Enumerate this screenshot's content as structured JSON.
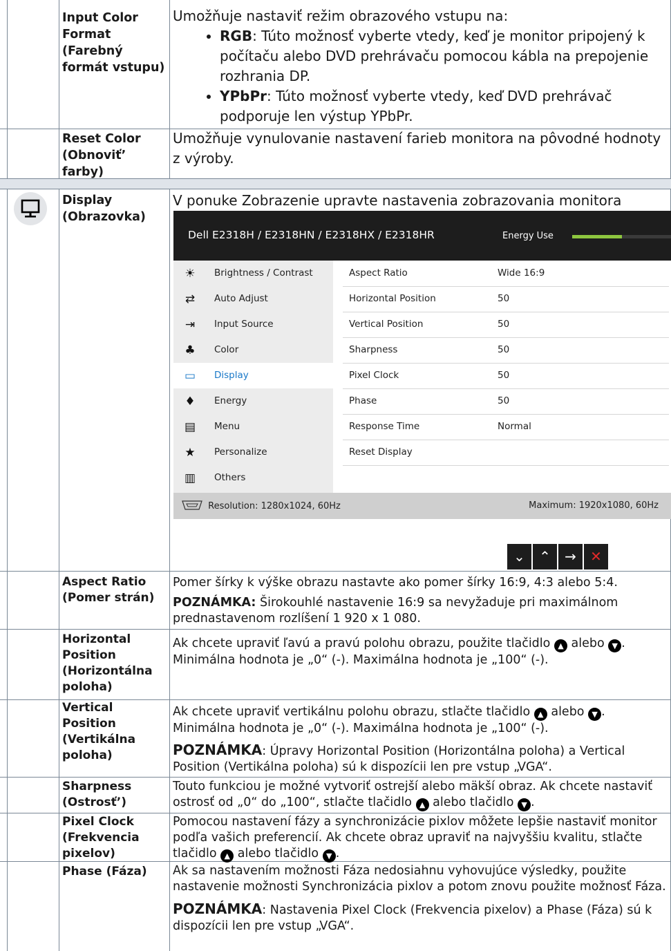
{
  "rows": {
    "input_color": {
      "label": [
        "Input Color",
        "Format",
        "(Farebný",
        "formát vstupu)"
      ],
      "desc_intro": "Umožňuje nastaviť režim obrazového vstupu na:",
      "bullets": [
        {
          "term": "RGB",
          "text": ": Túto možnosť vyberte vtedy, keď je monitor pripojený k počítaču alebo DVD prehrávaču pomocou kábla na prepojenie rozhrania DP."
        },
        {
          "term": "YPbPr",
          "text": ": Túto možnosť vyberte vtedy, keď DVD prehrávač podporuje len výstup YPbPr."
        }
      ]
    },
    "reset_color": {
      "label": [
        "Reset Color",
        "(Obnoviť’",
        "farby)"
      ],
      "desc": "Umožňuje vynulovanie nastavení farieb monitora na pôvodné hodnoty z výroby."
    },
    "display": {
      "label": [
        "Display",
        "(Obrazovka)"
      ],
      "desc": "V ponuke Zobrazenie upravte nastavenia zobrazovania monitora"
    },
    "aspect": {
      "label": [
        "Aspect Ratio",
        "(Pomer strán)"
      ],
      "desc": "Pomer šírky k výške obrazu nastavte ako pomer šírky 16:9, 4:3 alebo 5:4.",
      "note_prefix": "POZNÁMKA:",
      "note": " Širokouhlé nastavenie 16:9 sa nevyžaduje pri maximálnom prednastavenom rozlíšení 1 920 x 1 080."
    },
    "hpos": {
      "label": [
        "Horizontal",
        "Position",
        "(Horizontálna",
        "poloha)"
      ],
      "desc_a": "Ak chcete upraviť ľavú a pravú polohu obrazu, použite tlačidlo",
      "desc_b": "alebo",
      "desc_c": ".",
      "desc2": "Minimálna hodnota je „0“ (-). Maximálna hodnota je „100“ (-)."
    },
    "vpos": {
      "label": [
        "Vertical",
        "Position",
        "(Vertikálna",
        "poloha)"
      ],
      "desc_a": "Ak chcete upraviť vertikálnu polohu obrazu, stlačte tlačidlo",
      "desc_b": "alebo",
      "desc_c": ".",
      "desc2": "Minimálna hodnota je „0“ (-). Maximálna hodnota je „100“ (-).",
      "note_prefix": "POZNÁMKA",
      "note": ": Úpravy Horizontal Position (Horizontálna poloha) a Vertical Position (Vertikálna poloha) sú k dispozícii len pre vstup „VGA“."
    },
    "sharp": {
      "label": [
        "Sharpness",
        "(Ostrosť’)"
      ],
      "desc_a": "Touto funkciou je možné vytvoriť ostrejší alebo mäkší obraz. Ak chcete nastaviť ostrosť od „0“ do „100“, stlačte tlačidlo",
      "desc_b": "alebo tlačidlo",
      "desc_c": "."
    },
    "pixel": {
      "label": [
        "Pixel Clock",
        "(Frekvencia",
        "pixelov)"
      ],
      "desc_a": "Pomocou nastavení fázy a synchronizácie pixlov môžete lepšie nastaviť monitor podľa vašich preferencií. Ak chcete obraz upraviť na najvyššiu kvalitu, stlačte tlačidlo",
      "desc_b": "alebo tlačidlo",
      "desc_c": "."
    },
    "phase": {
      "label": [
        "Phase (Fáza)"
      ],
      "desc": "Ak sa nastavením možnosti Fáza nedosiahnu vyhovujúce výsledky, použite nastavenie možnosti Synchronizácia pixlov a potom znovu použite možnosť Fáza.",
      "note_prefix": "POZNÁMKA",
      "note": ": Nastavenia Pixel Clock (Frekvencia pixelov) a Phase (Fáza) sú k dispozícii len pre vstup „VGA“."
    }
  },
  "osd": {
    "model": "Dell E2318H / E2318HN / E2318HX / E2318HR",
    "energy_label": "Energy Use",
    "energy_level": 0.5,
    "menu": [
      {
        "icon": "brightness-icon",
        "glyph": "☀",
        "label": "Brightness / Contrast"
      },
      {
        "icon": "auto-adjust-icon",
        "glyph": "⇄",
        "label": "Auto Adjust"
      },
      {
        "icon": "input-source-icon",
        "glyph": "⇥",
        "label": "Input Source"
      },
      {
        "icon": "color-icon",
        "glyph": "♣",
        "label": "Color"
      },
      {
        "icon": "display-icon",
        "glyph": "▭",
        "label": "Display",
        "active": true
      },
      {
        "icon": "energy-icon",
        "glyph": "♦",
        "label": "Energy"
      },
      {
        "icon": "menu-icon",
        "glyph": "▤",
        "label": "Menu"
      },
      {
        "icon": "personalize-icon",
        "glyph": "★",
        "label": "Personalize"
      },
      {
        "icon": "others-icon",
        "glyph": "▥",
        "label": "Others"
      }
    ],
    "settings": [
      {
        "k": "Aspect Ratio",
        "v": "Wide 16:9"
      },
      {
        "k": "Horizontal Position",
        "v": "50"
      },
      {
        "k": "Vertical Position",
        "v": "50"
      },
      {
        "k": "Sharpness",
        "v": "50"
      },
      {
        "k": "Pixel Clock",
        "v": "50"
      },
      {
        "k": "Phase",
        "v": "50"
      },
      {
        "k": "Response Time",
        "v": "Normal"
      },
      {
        "k": "Reset Display",
        "v": ""
      }
    ],
    "resolution": "Resolution: 1280x1024, 60Hz",
    "maximum": "Maximum: 1920x1080, 60Hz",
    "buttons": [
      {
        "name": "down-button",
        "glyph": "⌄"
      },
      {
        "name": "up-button",
        "glyph": "⌃"
      },
      {
        "name": "right-button",
        "glyph": "→"
      },
      {
        "name": "exit-button",
        "glyph": "✕"
      }
    ]
  }
}
